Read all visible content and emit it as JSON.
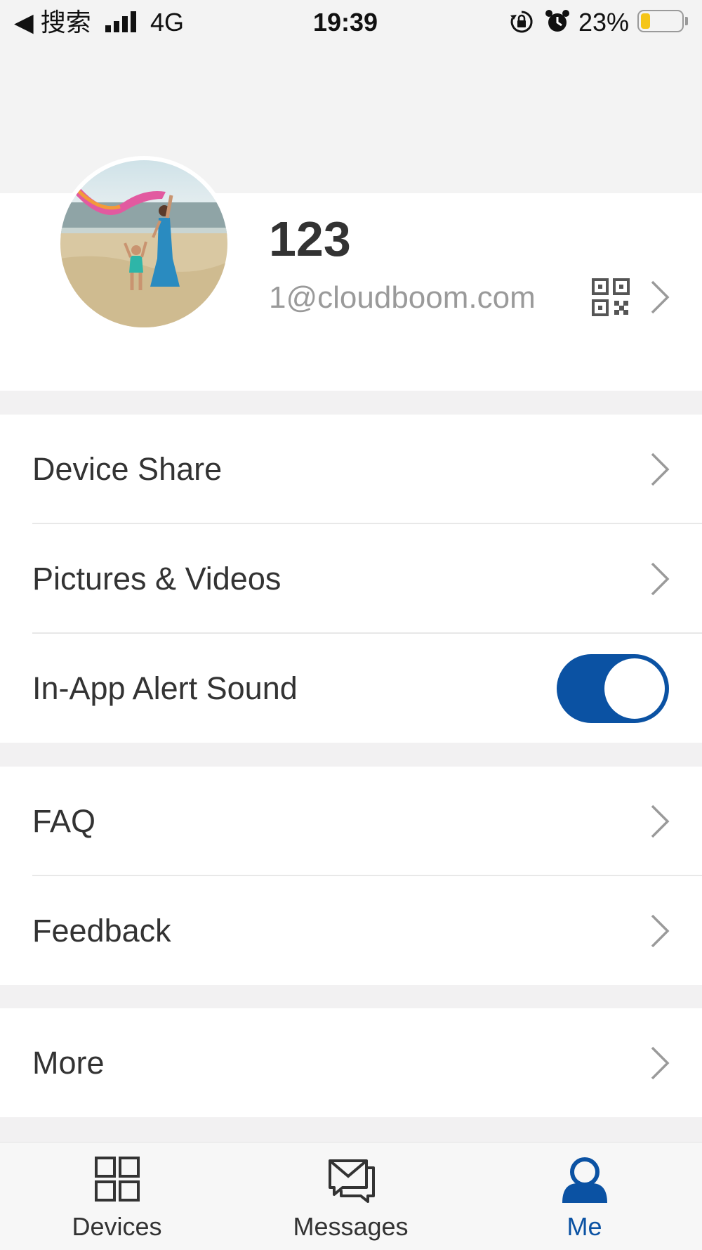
{
  "status_bar": {
    "back_label": "◀ 搜索",
    "network": "4G",
    "time": "19:39",
    "battery": "23%",
    "battery_level": 0.23
  },
  "profile": {
    "username": "123",
    "email": "1@cloudboom.com"
  },
  "menu": {
    "device_share": "Device Share",
    "pictures_videos": "Pictures & Videos",
    "alert_sound": "In-App Alert Sound",
    "alert_sound_on": true,
    "faq": "FAQ",
    "feedback": "Feedback",
    "more": "More"
  },
  "tabs": [
    {
      "label": "Devices",
      "icon": "grid-icon"
    },
    {
      "label": "Messages",
      "icon": "messages-icon"
    },
    {
      "label": "Me",
      "icon": "person-icon",
      "active": true
    }
  ],
  "colors": {
    "accent": "#0b52a3",
    "background": "#f2f1f2"
  }
}
